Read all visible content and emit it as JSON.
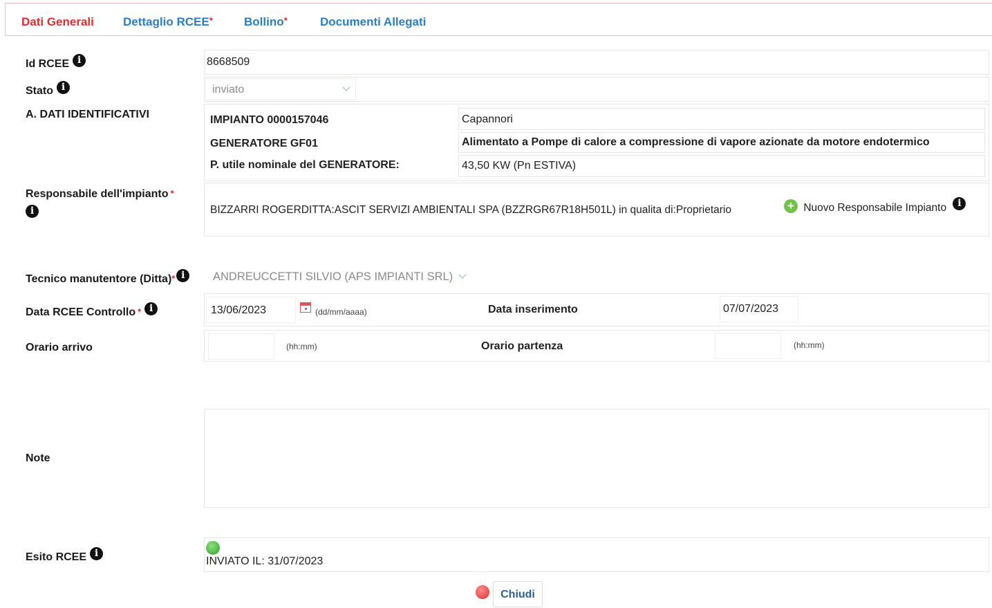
{
  "tabs": [
    {
      "label": "Dati Generali",
      "required": ""
    },
    {
      "label": "Dettaglio RCEE",
      "required": "*"
    },
    {
      "label": "Bollino",
      "required": "*"
    },
    {
      "label": "Documenti Allegati",
      "required": ""
    }
  ],
  "colors": {
    "tab_active": "#e02d2d",
    "tab_link": "#2a7fc6",
    "required": "#e02d2d",
    "status_ok": "#3cb043",
    "button_text": "#2b5f91"
  },
  "form": {
    "id_rcee": {
      "label": "Id RCEE",
      "value": "8668509"
    },
    "stato": {
      "label": "Stato",
      "value": "inviato"
    },
    "dati_identificativi": {
      "label": "A. DATI IDENTIFICATIVI",
      "impianto_label": "IMPIANTO 0000157046",
      "impianto_value": "Capannori",
      "generatore_label": "GENERATORE GF01",
      "generatore_value": "Alimentato a Pompe di calore a compressione di vapore azionate da motore endotermico",
      "potenza_label": "P. utile nominale del GENERATORE:",
      "potenza_value": "43,50 KW (Pn ESTIVA)"
    },
    "responsabile": {
      "label": "Responsabile dell'impianto",
      "required": "*",
      "value": "BIZZARRI ROGERDITTA:ASCIT SERVIZI AMBIENTALI SPA (BZZRGR67R18H501L) in qualita di:Proprietario",
      "new_link": "Nuovo Responsabile Impianto"
    },
    "tecnico": {
      "label": "Tecnico manutentore (Ditta)",
      "required": "*",
      "value": "ANDREUCCETTI SILVIO (APS IMPIANTI SRL)"
    },
    "data_controllo": {
      "label": "Data RCEE Controllo",
      "required": "*",
      "value": "13/06/2023",
      "format_hint": "(dd/mm/aaaa)"
    },
    "data_inserimento": {
      "label": "Data inserimento",
      "value": "07/07/2023"
    },
    "orario_arrivo": {
      "label": "Orario arrivo",
      "value": "",
      "format_hint": "(hh:mm)"
    },
    "orario_partenza": {
      "label": "Orario partenza",
      "value": "",
      "format_hint": "(hh:mm)"
    },
    "note": {
      "label": "Note",
      "value": ""
    },
    "esito": {
      "label": "Esito RCEE",
      "value": "INVIATO IL: 31/07/2023"
    }
  },
  "actions": {
    "close_label": "Chiudi"
  },
  "icons": {
    "info": "info-icon",
    "calendar": "calendar-icon",
    "add": "add-circle-icon",
    "status": "green-status-icon",
    "close": "red-close-icon",
    "dropdown": "chevron-down-icon"
  }
}
